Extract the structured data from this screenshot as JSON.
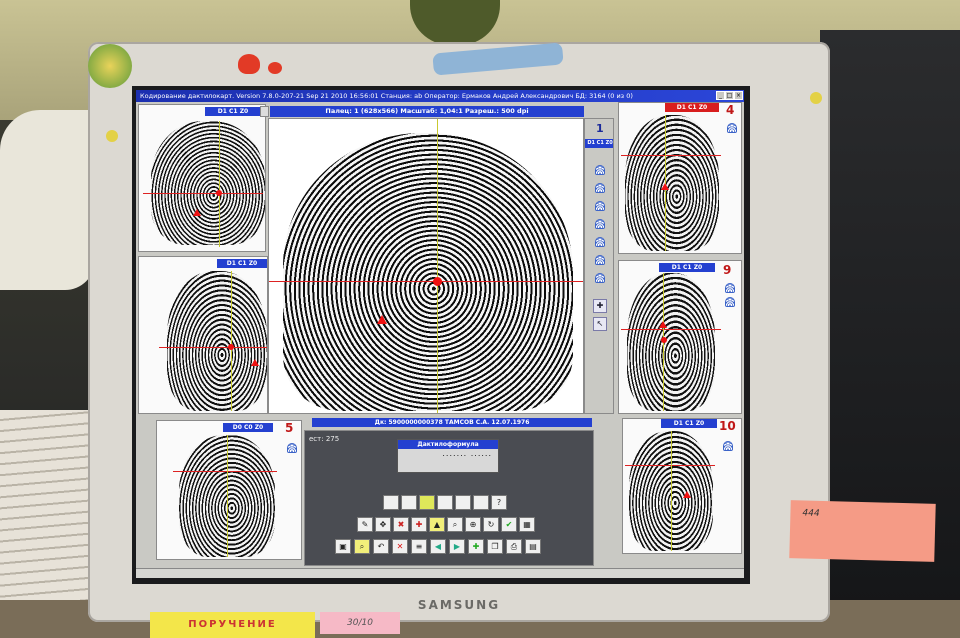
{
  "window": {
    "title": "Кодирование дактилокарт. Version 7.8.0-207-21  Sep 21 2010 16:56:01  Станция: ab  Оператор: Ермаков Андрей Александрович  БД: 3164  (0 из 0)"
  },
  "main_view": {
    "header": "Палец: 1 (628х566)   Масштаб: 1,04:1   Разреш.: 500 dpi",
    "finger_number": "1",
    "code": "D1 C1 Z0"
  },
  "fingers": [
    {
      "number": "",
      "code": "D1 C1 Z0"
    },
    {
      "number": "",
      "code": "D1 C1 Z0"
    },
    {
      "number": "4",
      "code": "D1 C1 Z0"
    },
    {
      "number": "9",
      "code": "D1 C1 Z0"
    },
    {
      "number": "5",
      "code": "D0 C0 Z0"
    },
    {
      "number": "10",
      "code": "D1 C1 Z0"
    }
  ],
  "person_bar": "Дк: 5900000000378  ТАМСОВ С.А. 12.07.1976",
  "count_label": "ест: 275",
  "formula": {
    "title": "Дактилоформула",
    "value": "....... ......"
  },
  "monitor": {
    "brand": "SAMSUNG"
  },
  "notes": {
    "yellow": "ПОРУЧЕНИЕ",
    "pink_small": "30/10",
    "pink_large": "444"
  },
  "icons": {
    "pattern_types": [
      "arch-icon",
      "tented-arch-icon",
      "loop-left-icon",
      "loop-right-icon",
      "whorl-icon",
      "double-loop-icon",
      "unknown-icon"
    ],
    "toolbar_row1": [
      "edit-icon",
      "move-icon",
      "delete-point-icon",
      "add-point-icon",
      "delta-icon",
      "zoom-icon",
      "center-icon",
      "rotate-icon",
      "confirm-icon",
      "grid-icon"
    ],
    "toolbar_row2": [
      "select-icon",
      "search-icon",
      "undo-icon",
      "close-icon",
      "list-icon",
      "prev-icon",
      "next-icon",
      "apply-icon",
      "copy-icon",
      "print-icon",
      "save-icon"
    ]
  },
  "colors": {
    "titlebar": "#1b2fb0",
    "header": "#2440d0",
    "accent_red": "#d81e1e",
    "core_marker": "#e11111"
  }
}
